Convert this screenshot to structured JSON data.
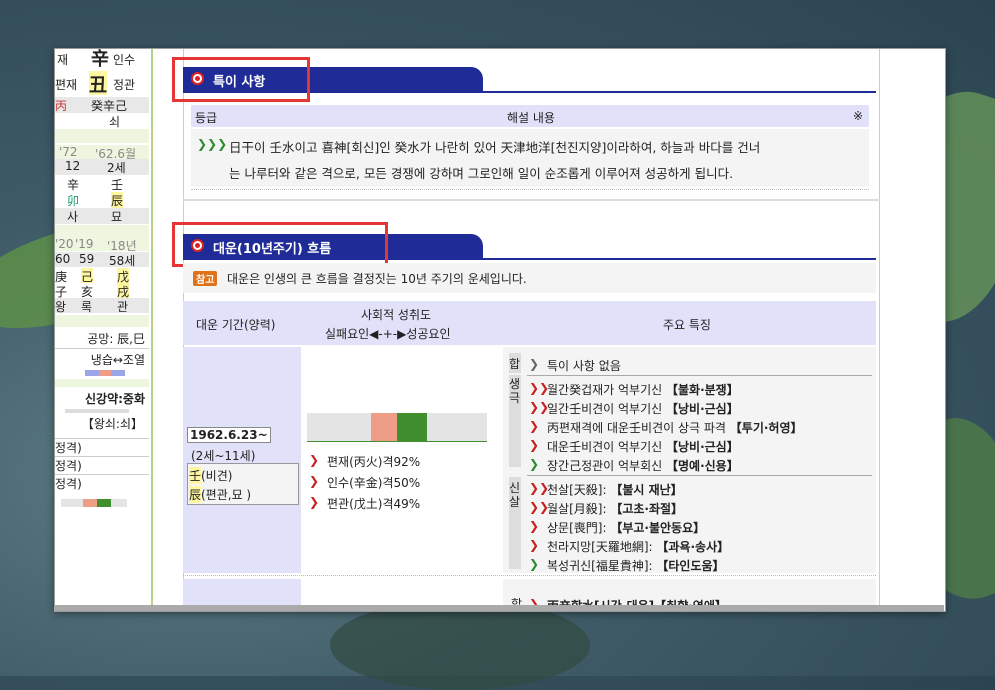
{
  "left_panel": {
    "row1": [
      "재",
      "辛",
      "인수"
    ],
    "row2": [
      "편재",
      "丑",
      "정관"
    ],
    "row3": [
      "丙",
      "癸辛己"
    ],
    "row4": "쇠",
    "years1": [
      "'72",
      "'62.6월"
    ],
    "ages1": [
      "12",
      "2세"
    ],
    "stem1": [
      "辛",
      "壬"
    ],
    "branch1": [
      "卯",
      "辰"
    ],
    "state1": [
      "사",
      "묘"
    ],
    "years2": [
      "'20",
      "'19",
      "'18년"
    ],
    "ages2": [
      "60",
      "59",
      "58세"
    ],
    "stem2": [
      "庚",
      "己",
      "戊"
    ],
    "branch2": [
      "子",
      "亥",
      "戌"
    ],
    "state2": [
      "왕",
      "록",
      "관"
    ],
    "gongmang": "공망: 辰,巳",
    "temp": "냉습↔조열",
    "strength": "신강약:중화",
    "wangsoe": "【왕쇠:쇠】",
    "gyeok_rows": [
      "정격)",
      "정격)",
      "정격)"
    ]
  },
  "special": {
    "title": "특이 사항",
    "col_grade": "등급",
    "col_desc": "해설 내용",
    "col_mark": "※",
    "line1": "日干이 壬水이고 喜神[회신]인 癸水가 나란히 있어 天津地洋[천진지양]이라하여, 하늘과 바다를 건너",
    "line2": "는 나루터와 같은 격으로, 모든 경쟁에 강하며 그로인해 일이 순조롭게 이루어져 성공하게 됩니다."
  },
  "daewoon": {
    "title": "대운(10년주기) 흐름",
    "note_badge": "참고",
    "note": "대운은 인생의 큰 흐름을 결정짓는 10년 주기의 운세입니다.",
    "col_period": "대운 기간(양력)",
    "col_social": "사회적 성취도",
    "col_social_sub": "실패요인◀-+-▶성공요인",
    "col_features": "주요 특징",
    "date": "1962.6.23~",
    "age": "(2세~11세)",
    "stem": "壬",
    "stem_note": "(비견)",
    "branch": "辰",
    "branch_note": "(편관,묘 )",
    "gyeok": [
      {
        "label": "편재(丙火)격92%"
      },
      {
        "label": "인수(辛金)격50%"
      },
      {
        "label": "편관(戊土)격49%"
      }
    ],
    "group_hap": "합",
    "group_saeng": "생극",
    "group_sinsal": "신살",
    "hap_items": [
      {
        "text": "특이 사항 없음",
        "tag": ""
      }
    ],
    "saeng_items": [
      {
        "text": "월간癸겁재가 억부기신 ",
        "tag": "【불화·분쟁】"
      },
      {
        "text": "일간壬비견이 억부기신 ",
        "tag": "【낭비·근심】"
      },
      {
        "text": "丙편재격에 대운壬비견이 상극 파격 ",
        "tag": "【투기·허영】"
      },
      {
        "text": "대운壬비견이 억부기신 ",
        "tag": "【낭비·근심】"
      },
      {
        "text": "장간己정관이 억부회신 ",
        "tag": "【명예·신용】"
      }
    ],
    "sinsal_items": [
      {
        "text": "천살[天殺]: ",
        "tag": "【불시 재난】"
      },
      {
        "text": "월살[月殺]: ",
        "tag": "【고초·좌절】"
      },
      {
        "text": "상문[喪門]: ",
        "tag": "【부고·불안동요】"
      },
      {
        "text": "천라지망[天羅地網]: ",
        "tag": "【과욕·송사】"
      },
      {
        "text": "복성귀신[福星貴神]: ",
        "tag": "【타인도움】"
      }
    ],
    "next_group": "합",
    "next_partial": "丙辛합水[시간-대운]【취향·연애】"
  },
  "colors": {
    "accent": "#1f2b96",
    "highlight_box": "#e53535",
    "header_bg": "#e1e1fa",
    "bar_green": "#3f8f2f",
    "bar_red": "#ef9d88"
  },
  "icons": {
    "section": "target-icon",
    "bullet_green": "chevron-right-icon",
    "bullet_red": "double-chevron-right-icon"
  }
}
